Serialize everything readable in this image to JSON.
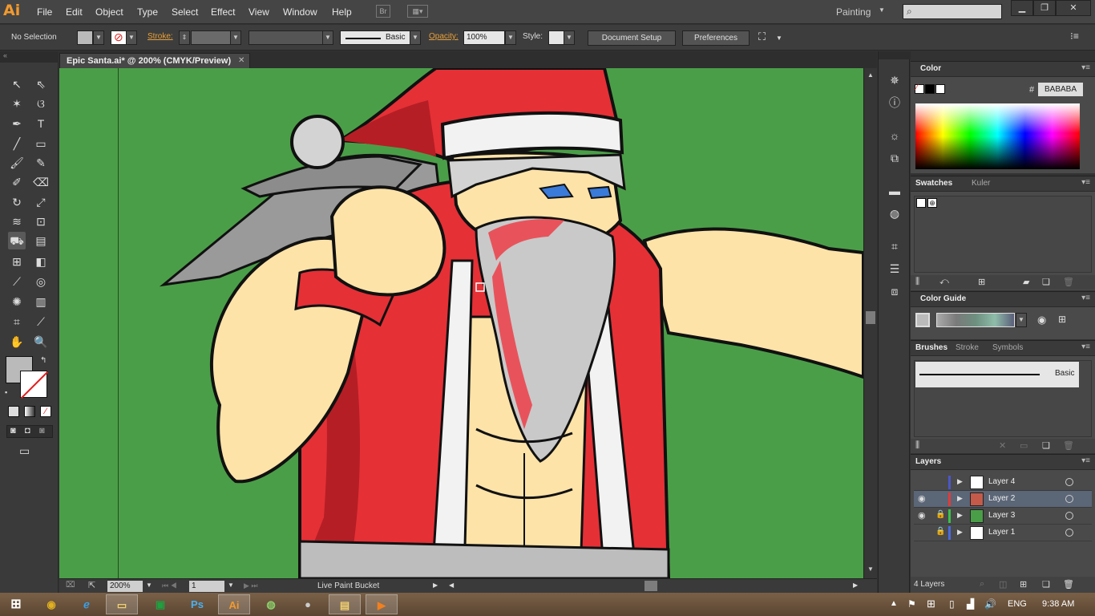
{
  "app": {
    "logo": "Ai",
    "workspace": "Painting"
  },
  "menu": [
    "File",
    "Edit",
    "Object",
    "Type",
    "Select",
    "Effect",
    "View",
    "Window",
    "Help"
  ],
  "menubar_icons": {
    "bridge": "Br"
  },
  "control": {
    "selection": "No Selection",
    "stroke_label": "Stroke:",
    "brush": "Basic",
    "opacity_label": "Opacity:",
    "opacity_value": "100%",
    "style_label": "Style:",
    "document_setup": "Document Setup",
    "preferences": "Preferences"
  },
  "document": {
    "tab_title": "Epic Santa.ai* @ 200% (CMYK/Preview)"
  },
  "status": {
    "zoom": "200%",
    "page": "1",
    "tool": "Live Paint Bucket"
  },
  "panels": {
    "color": {
      "title": "Color",
      "hex_label": "#",
      "hex_value": "BABABA"
    },
    "swatches": {
      "tabs": [
        "Swatches",
        "Kuler"
      ]
    },
    "color_guide": {
      "title": "Color Guide"
    },
    "brushes": {
      "tabs": [
        "Brushes",
        "Stroke",
        "Symbols"
      ],
      "brush_name": "Basic"
    },
    "layers": {
      "title": "Layers",
      "items": [
        {
          "name": "Layer 4",
          "color": "#4a57c8"
        },
        {
          "name": "Layer 2",
          "color": "#e23a3a"
        },
        {
          "name": "Layer 3",
          "color": "#3ac24a"
        },
        {
          "name": "Layer 1",
          "color": "#4a6ae0"
        }
      ],
      "count": "4 Layers"
    }
  },
  "colors": {
    "fill": "#bababa",
    "canvas": "#4b9e48",
    "accent": "#f29a2e"
  },
  "taskbar": {
    "lang": "ENG",
    "time": "9:38 AM",
    "ps_label": "Ps",
    "ai_label": "Ai"
  }
}
